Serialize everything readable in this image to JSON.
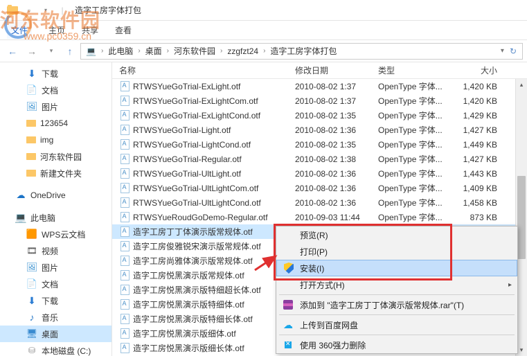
{
  "window": {
    "title": "造字工房字体打包"
  },
  "ribbon": {
    "tab_file": "文件",
    "tab_home": "主页",
    "tab_share": "共享",
    "tab_view": "查看"
  },
  "breadcrumb": {
    "root_icon": "pc",
    "items": [
      "此电脑",
      "桌面",
      "河东软件园",
      "zzgfzt24",
      "造字工房字体打包"
    ]
  },
  "sidebar": {
    "items": [
      {
        "icon": "dl",
        "label": "下载"
      },
      {
        "icon": "doc",
        "label": "文档"
      },
      {
        "icon": "pic",
        "label": "图片"
      },
      {
        "icon": "folder",
        "label": "123654"
      },
      {
        "icon": "folder",
        "label": "img"
      },
      {
        "icon": "folder",
        "label": "河东软件园"
      },
      {
        "icon": "folder",
        "label": "新建文件夹"
      }
    ],
    "onedrive": {
      "icon": "cloud",
      "label": "OneDrive"
    },
    "thispc": {
      "icon": "pc",
      "label": "此电脑"
    },
    "pc_children": [
      {
        "icon": "wps",
        "label": "WPS云文档"
      },
      {
        "icon": "vid",
        "label": "视频"
      },
      {
        "icon": "pic",
        "label": "图片"
      },
      {
        "icon": "doc",
        "label": "文档"
      },
      {
        "icon": "dl",
        "label": "下载"
      },
      {
        "icon": "music",
        "label": "音乐"
      },
      {
        "icon": "desk",
        "label": "桌面",
        "selected": true
      },
      {
        "icon": "disk",
        "label": "本地磁盘 (C:)"
      }
    ]
  },
  "columns": {
    "name": "名称",
    "date": "修改日期",
    "type": "类型",
    "size": "大小"
  },
  "files": [
    {
      "name": "RTWSYueGoTrial-ExLight.otf",
      "date": "2010-08-02 1:37",
      "type": "OpenType 字体...",
      "size": "1,420 KB"
    },
    {
      "name": "RTWSYueGoTrial-ExLightCom.otf",
      "date": "2010-08-02 1:37",
      "type": "OpenType 字体...",
      "size": "1,420 KB"
    },
    {
      "name": "RTWSYueGoTrial-ExLightCond.otf",
      "date": "2010-08-02 1:35",
      "type": "OpenType 字体...",
      "size": "1,429 KB"
    },
    {
      "name": "RTWSYueGoTrial-Light.otf",
      "date": "2010-08-02 1:36",
      "type": "OpenType 字体...",
      "size": "1,427 KB"
    },
    {
      "name": "RTWSYueGoTrial-LightCond.otf",
      "date": "2010-08-02 1:35",
      "type": "OpenType 字体...",
      "size": "1,449 KB"
    },
    {
      "name": "RTWSYueGoTrial-Regular.otf",
      "date": "2010-08-02 1:38",
      "type": "OpenType 字体...",
      "size": "1,427 KB"
    },
    {
      "name": "RTWSYueGoTrial-UltLight.otf",
      "date": "2010-08-02 1:36",
      "type": "OpenType 字体...",
      "size": "1,443 KB"
    },
    {
      "name": "RTWSYueGoTrial-UltLightCom.otf",
      "date": "2010-08-02 1:36",
      "type": "OpenType 字体...",
      "size": "1,409 KB"
    },
    {
      "name": "RTWSYueGoTrial-UltLightCond.otf",
      "date": "2010-08-02 1:36",
      "type": "OpenType 字体...",
      "size": "1,458 KB"
    },
    {
      "name": "RTWSYueRoudGoDemo-Regular.otf",
      "date": "2010-09-03 11:44",
      "type": "OpenType 字体...",
      "size": "873 KB"
    },
    {
      "name": "造字工房丁丁体演示版常规体.otf",
      "date": "",
      "type": "",
      "size": "",
      "selected": true
    },
    {
      "name": "造字工房俊雅锐宋演示版常规体.otf",
      "date": "",
      "type": "",
      "size": ""
    },
    {
      "name": "造字工房尚雅体演示版常规体.otf",
      "date": "",
      "type": "",
      "size": ""
    },
    {
      "name": "造字工房悦黑演示版常规体.otf",
      "date": "",
      "type": "",
      "size": ""
    },
    {
      "name": "造字工房悦黑演示版特细超长体.otf",
      "date": "",
      "type": "",
      "size": ""
    },
    {
      "name": "造字工房悦黑演示版特细体.otf",
      "date": "",
      "type": "",
      "size": ""
    },
    {
      "name": "造字工房悦黑演示版特细长体.otf",
      "date": "",
      "type": "",
      "size": ""
    },
    {
      "name": "造字工房悦黑演示版细体.otf",
      "date": "",
      "type": "",
      "size": ""
    },
    {
      "name": "造字工房悦黑演示版细长体.otf",
      "date": "",
      "type": "",
      "size": ""
    }
  ],
  "context_menu": {
    "preview": "预览(R)",
    "print": "打印(P)",
    "install": "安装(I)",
    "openwith": "打开方式(H)",
    "addto_rar": "添加到 \"造字工房丁丁体演示版常规体.rar\"(T)",
    "upload_baidu": "上传到百度网盘",
    "del360": "使用 360强力删除"
  },
  "watermark": {
    "t1": "河东软件园",
    "t2": "www.pc0359.cn"
  }
}
